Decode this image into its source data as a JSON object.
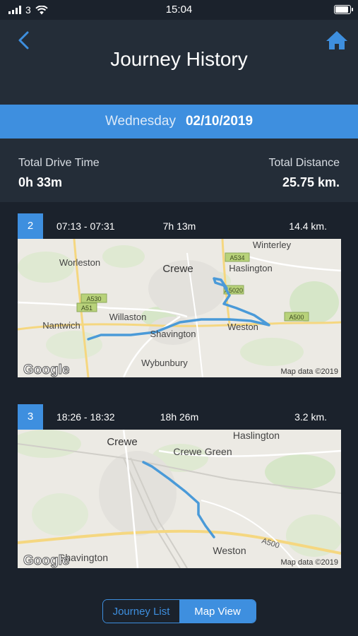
{
  "status": {
    "carrier": "3",
    "time": "15:04"
  },
  "header": {
    "title": "Journey History"
  },
  "date": {
    "day": "Wednesday",
    "date": "02/10/2019"
  },
  "totals": {
    "drive_time_label": "Total Drive Time",
    "drive_time_value": "0h 33m",
    "distance_label": "Total Distance",
    "distance_value": "25.75 km."
  },
  "journeys": [
    {
      "number": "2",
      "time_range": "07:13 - 07:31",
      "duration": "7h 13m",
      "distance": "14.4 km.",
      "map": {
        "places": [
          "Winterley",
          "Worleston",
          "Crewe",
          "Haslington",
          "Willaston",
          "Nantwich",
          "Weston",
          "Shavington",
          "Wybunbury"
        ],
        "roads": [
          "A534",
          "A5020",
          "A530",
          "A51",
          "A500"
        ],
        "attribution": "Map data ©2019",
        "logo": "Google"
      }
    },
    {
      "number": "3",
      "time_range": "18:26 - 18:32",
      "duration": "18h 26m",
      "distance": "3.2 km.",
      "map": {
        "places": [
          "Haslington",
          "Crewe",
          "Crewe Green",
          "Weston",
          "Shavington"
        ],
        "roads": [
          "A500"
        ],
        "attribution": "Map data ©2019",
        "logo": "Google"
      }
    }
  ],
  "view_toggle": {
    "list_label": "Journey List",
    "map_label": "Map View",
    "selected": "Map View"
  },
  "colors": {
    "accent": "#3e8fdf",
    "background": "#1b222c",
    "panel": "#242d38",
    "route": "#4a9ad8"
  }
}
